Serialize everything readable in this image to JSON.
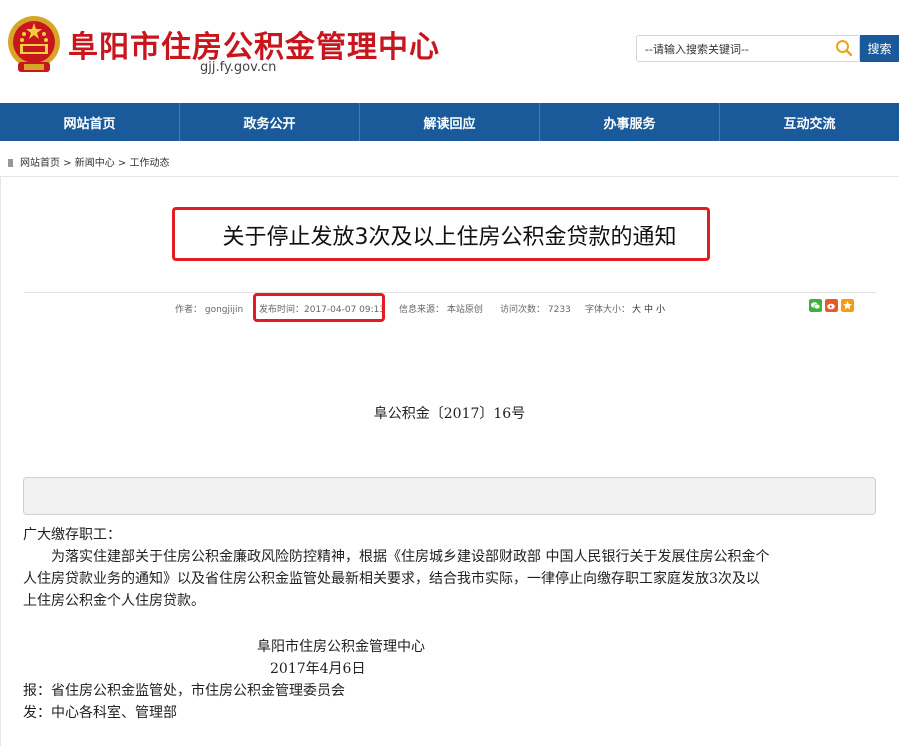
{
  "header": {
    "site_title": "阜阳市住房公积金管理中心",
    "site_domain": "gjj.fy.gov.cn",
    "search": {
      "placeholder": "--请输入搜索关键词--",
      "button_label": "搜索"
    }
  },
  "nav": {
    "items": [
      {
        "label": "网站首页"
      },
      {
        "label": "政务公开"
      },
      {
        "label": "解读回应"
      },
      {
        "label": "办事服务"
      },
      {
        "label": "互动交流"
      }
    ]
  },
  "breadcrumb": {
    "home": "网站首页",
    "sep1": " > ",
    "section": "新闻中心",
    "sep2": " > ",
    "current": "工作动态"
  },
  "article": {
    "title": "关于停止发放3次及以上住房公积金贷款的通知",
    "meta": {
      "author": "作者：  gongjijin",
      "publish_time": "发布时间：2017-04-07 09:13",
      "source": "信息来源：  本站原创",
      "views": "访问次数：  7233",
      "font_size_label": "字体大小：",
      "font_large": "大",
      "font_medium": "中",
      "font_small": "小"
    },
    "doc_number": "阜公积金〔2017〕16号",
    "greeting": "广大缴存职工：",
    "paragraph_lines": [
      "为落实住建部关于住房公积金廉政风险防控精神，根据《住房城乡建设部财政部 中国人民银行关于发展住房公积金个",
      "人住房贷款业务的通知》以及省住房公积金监管处最新相关要求，结合我市实际，一律停止向缴存职工家庭发放3次及以",
      "上住房公积金个人住房贷款。"
    ],
    "signature_org": "阜阳市住房公积金管理中心",
    "signature_date": "2017年4月6日",
    "report_to": "报：省住房公积金监管处，市住房公积金管理委员会",
    "send_to": "发：中心各科室、管理部"
  },
  "colors": {
    "brand_red": "#c8161e",
    "nav_blue": "#1a5a9a",
    "highlight_red": "#e01e22"
  },
  "icons": [
    "national-emblem-icon",
    "search-icon",
    "breadcrumb-home-icon",
    "wechat-share-icon",
    "weibo-share-icon",
    "favorite-share-icon"
  ]
}
